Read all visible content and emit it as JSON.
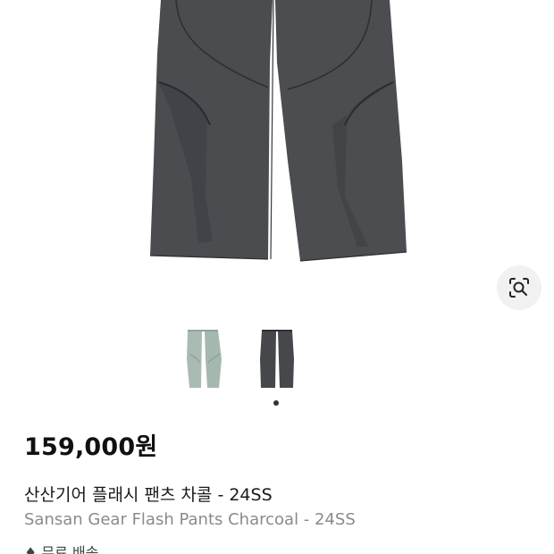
{
  "gallery": {
    "variants": [
      {
        "name": "mint",
        "color": "#a9bbb3"
      },
      {
        "name": "charcoal",
        "color": "#45474b"
      }
    ],
    "selected_index": 1,
    "lens_icon": "visual-search-icon"
  },
  "product": {
    "price": "159,000원",
    "title_ko": "산산기어 플래시 팬츠 차콜 - 24SS",
    "title_en": "Sansan Gear Flash Pants Charcoal - 24SS",
    "next_line": "♦ 무료 배송"
  },
  "colors": {
    "pants_main": "#4a4c50",
    "pants_shadow": "#3b3d41",
    "seam": "#2e2f33",
    "mint": "#a9bbb3",
    "price_text": "#111111",
    "secondary_text": "#8a8a8a"
  }
}
